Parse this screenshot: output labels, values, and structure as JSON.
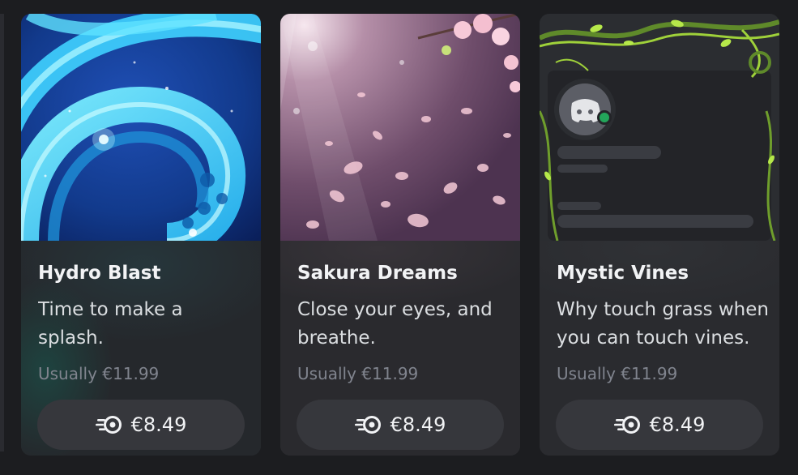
{
  "cards": [
    {
      "title": "Hydro Blast",
      "description": "Time to make a splash.",
      "original_price": "Usually €11.99",
      "price": "€8.49",
      "price_icon": "nitro-icon"
    },
    {
      "title": "Sakura Dreams",
      "description": "Close your eyes, and breathe.",
      "original_price": "Usually €11.99",
      "price": "€8.49",
      "price_icon": "nitro-icon"
    },
    {
      "title": "Mystic Vines",
      "description": "Why touch grass when you can touch vines.",
      "original_price": "Usually €11.99",
      "price": "€8.49",
      "price_icon": "nitro-icon"
    }
  ],
  "colors": {
    "page_background": "#1c1d20",
    "card_background": "#2b2c30",
    "price_button": "#36373c",
    "title_text": "#f2f3f5",
    "muted_text": "#80848e",
    "hydro_accent": "#4fd8ff",
    "sakura_accent": "#f4c9d6",
    "vines_accent": "#9fd13a",
    "online_status": "#23a55a"
  }
}
